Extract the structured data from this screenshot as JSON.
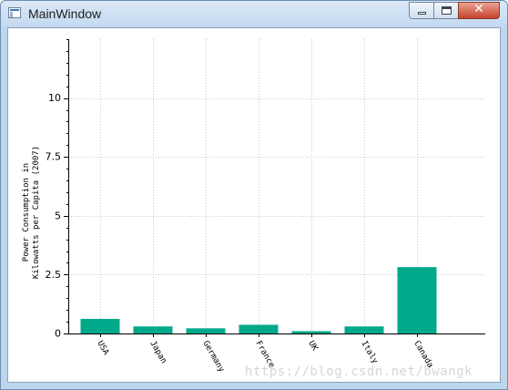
{
  "window": {
    "title": "MainWindow",
    "close_glyph": "✕"
  },
  "chart_data": {
    "type": "bar",
    "categories": [
      "USA",
      "Japan",
      "Germany",
      "France",
      "UK",
      "Italy",
      "Canada"
    ],
    "values": [
      0.62,
      0.3,
      0.22,
      0.37,
      0.1,
      0.3,
      2.82
    ],
    "ylabel": "Power Consumption in\nKilowatts per Capita (2007)",
    "xlabel": "",
    "ylim": [
      0,
      12.5
    ],
    "yticks": [
      0,
      2.5,
      5,
      7.5,
      10
    ],
    "ytick_labels": [
      "0",
      "2.5",
      "5",
      "7.5",
      "10"
    ],
    "grid": true,
    "bar_color": "#00a98a"
  },
  "watermark": "https://blog.csdn.net/bwangk"
}
